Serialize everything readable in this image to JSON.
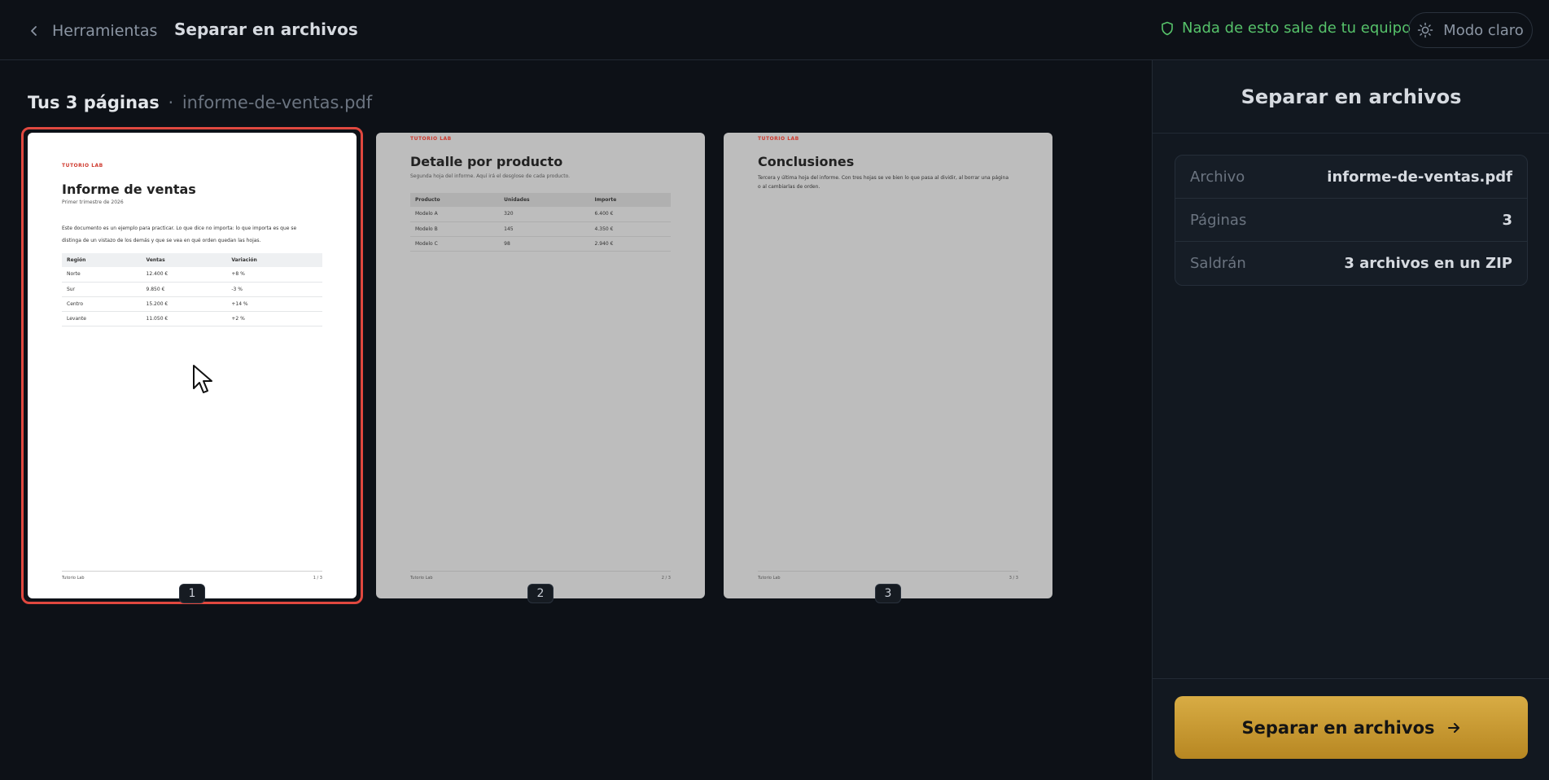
{
  "header": {
    "back_label": "Herramientas",
    "title": "Separar en archivos",
    "privacy_text": "Nada de esto sale de tu equipo",
    "theme_label": "Modo claro"
  },
  "main": {
    "heading_strong": "Tus 3 páginas",
    "heading_sep": "·",
    "heading_file": "informe-de-ventas.pdf"
  },
  "pages": [
    {
      "number": "1",
      "brand": "TUTORIO LAB",
      "title": "Informe de ventas",
      "subtitle": "Primer trimestre de 2026",
      "paragraph": "Este documento es un ejemplo para practicar. Lo que dice no importa: lo que importa es que se distinga de un vistazo de los demás y que se vea en qué orden quedan las hojas.",
      "table": {
        "headers": [
          "Región",
          "Ventas",
          "Variación"
        ],
        "rows": [
          [
            "Norte",
            "12.400 €",
            "+8 %"
          ],
          [
            "Sur",
            "9.850 €",
            "-3 %"
          ],
          [
            "Centro",
            "15.200 €",
            "+14 %"
          ],
          [
            "Levante",
            "11.050 €",
            "+2 %"
          ]
        ]
      },
      "footer_left": "Tutorio Lab",
      "footer_right": "1 / 3"
    },
    {
      "number": "2",
      "brand": "TUTORIO LAB",
      "title": "Detalle por producto",
      "subtitle": "Segunda hoja del informe. Aquí irá el desglose de cada producto.",
      "table": {
        "headers": [
          "Producto",
          "Unidades",
          "Importe"
        ],
        "rows": [
          [
            "Modelo A",
            "320",
            "6.400 €"
          ],
          [
            "Modelo B",
            "145",
            "4.350 €"
          ],
          [
            "Modelo C",
            "98",
            "2.940 €"
          ]
        ]
      },
      "footer_left": "Tutorio Lab",
      "footer_right": "2 / 3"
    },
    {
      "number": "3",
      "brand": "TUTORIO LAB",
      "title": "Conclusiones",
      "paragraph": "Tercera y última hoja del informe. Con tres hojas se ve bien lo que pasa al dividir, al borrar una página o al cambiarlas de orden.",
      "footer_left": "Tutorio Lab",
      "footer_right": "3 / 3"
    }
  ],
  "sidebar": {
    "title": "Separar en archivos",
    "info": [
      {
        "label": "Archivo",
        "value": "informe-de-ventas.pdf"
      },
      {
        "label": "Páginas",
        "value": "3"
      },
      {
        "label": "Saldrán",
        "value": "3 archivos en un ZIP"
      }
    ],
    "action_label": "Separar en archivos"
  },
  "colors": {
    "background": "#0d1117",
    "accent": "#d8ac44",
    "selection": "#e0483f",
    "privacy": "#56c26a"
  },
  "icons": {
    "back": "chevron-left-icon",
    "privacy": "shield-icon",
    "theme": "sun-icon",
    "action": "arrow-right-icon"
  }
}
